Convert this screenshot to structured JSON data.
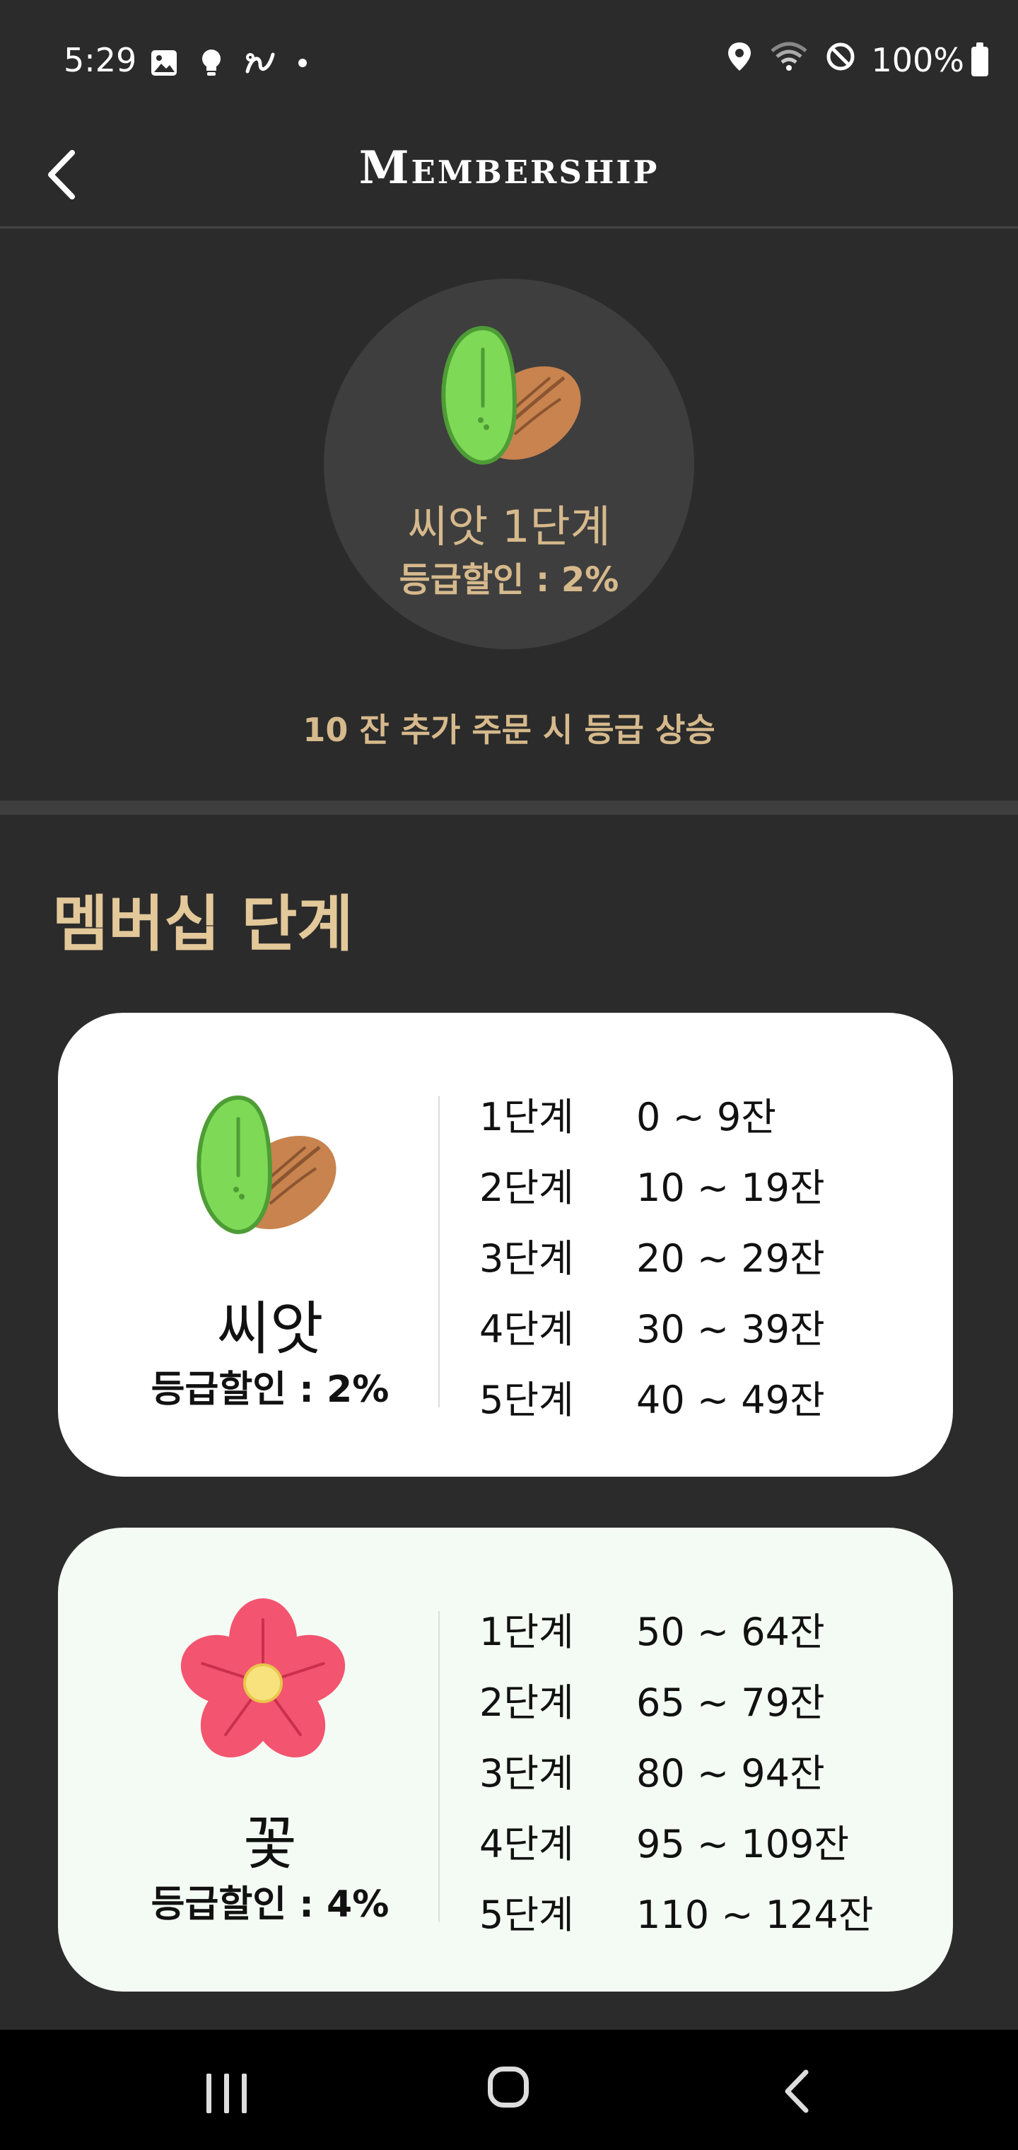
{
  "status_bar": {
    "time": "5:29",
    "battery": "100%",
    "left_icons": [
      "image-icon",
      "lightbulb-icon",
      "link-icon",
      "dot-icon"
    ],
    "right_icons": [
      "location-icon",
      "wifi-icon",
      "do-not-disturb-icon",
      "battery-icon"
    ]
  },
  "header": {
    "title": "Membership"
  },
  "current_level": {
    "name": "씨앗 1단계",
    "discount": "등급할인 : 2%",
    "icon": "almond-seed-icon"
  },
  "upgrade_note": "10 잔 추가 주문 시 등급 상승",
  "section_title": "멤버십 단계",
  "tiers": [
    {
      "name": "씨앗",
      "discount": "등급할인 : 2%",
      "icon": "almond-seed-icon",
      "levels": [
        {
          "stage": "1단계",
          "range": "0 ~ 9잔"
        },
        {
          "stage": "2단계",
          "range": "10 ~ 19잔"
        },
        {
          "stage": "3단계",
          "range": "20 ~ 29잔"
        },
        {
          "stage": "4단계",
          "range": "30 ~ 39잔"
        },
        {
          "stage": "5단계",
          "range": "40 ~ 49잔"
        }
      ]
    },
    {
      "name": "꽃",
      "discount": "등급할인 : 4%",
      "icon": "flower-icon",
      "levels": [
        {
          "stage": "1단계",
          "range": "50 ~ 64잔"
        },
        {
          "stage": "2단계",
          "range": "65 ~ 79잔"
        },
        {
          "stage": "3단계",
          "range": "80 ~ 94잔"
        },
        {
          "stage": "4단계",
          "range": "95 ~ 109잔"
        },
        {
          "stage": "5단계",
          "range": "110 ~ 124잔"
        }
      ]
    }
  ],
  "colors": {
    "background": "#2b2b2b",
    "accent": "#d6b98c",
    "card": "#ffffff",
    "card_flower": "#f4fbf4"
  }
}
